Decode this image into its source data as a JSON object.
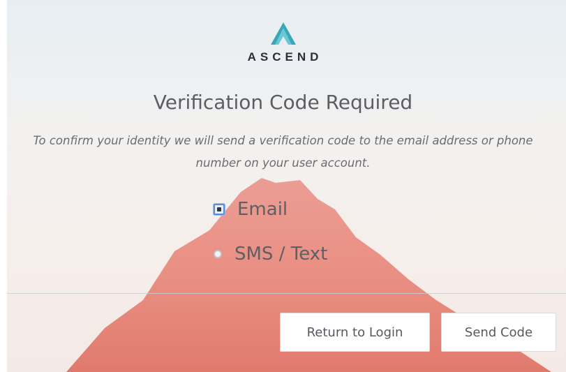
{
  "brand": {
    "logo_icon": "ascend-mountain-logo-icon",
    "name": "ASCEND",
    "accent_color": "#3a9fb0"
  },
  "page": {
    "title": "Verification Code Required",
    "description": "To confirm your identity we will send a verification code to the email address or phone number on your user account."
  },
  "delivery_options": {
    "selected": "Email",
    "items": [
      {
        "label": "Email",
        "checked": true
      },
      {
        "label": "SMS / Text",
        "checked": false
      }
    ]
  },
  "actions": {
    "return_label": "Return to Login",
    "send_label": "Send Code"
  },
  "colors": {
    "mountain": "#d9453a",
    "title_text": "#5a5d63",
    "button_border": "#d9dcdf"
  }
}
